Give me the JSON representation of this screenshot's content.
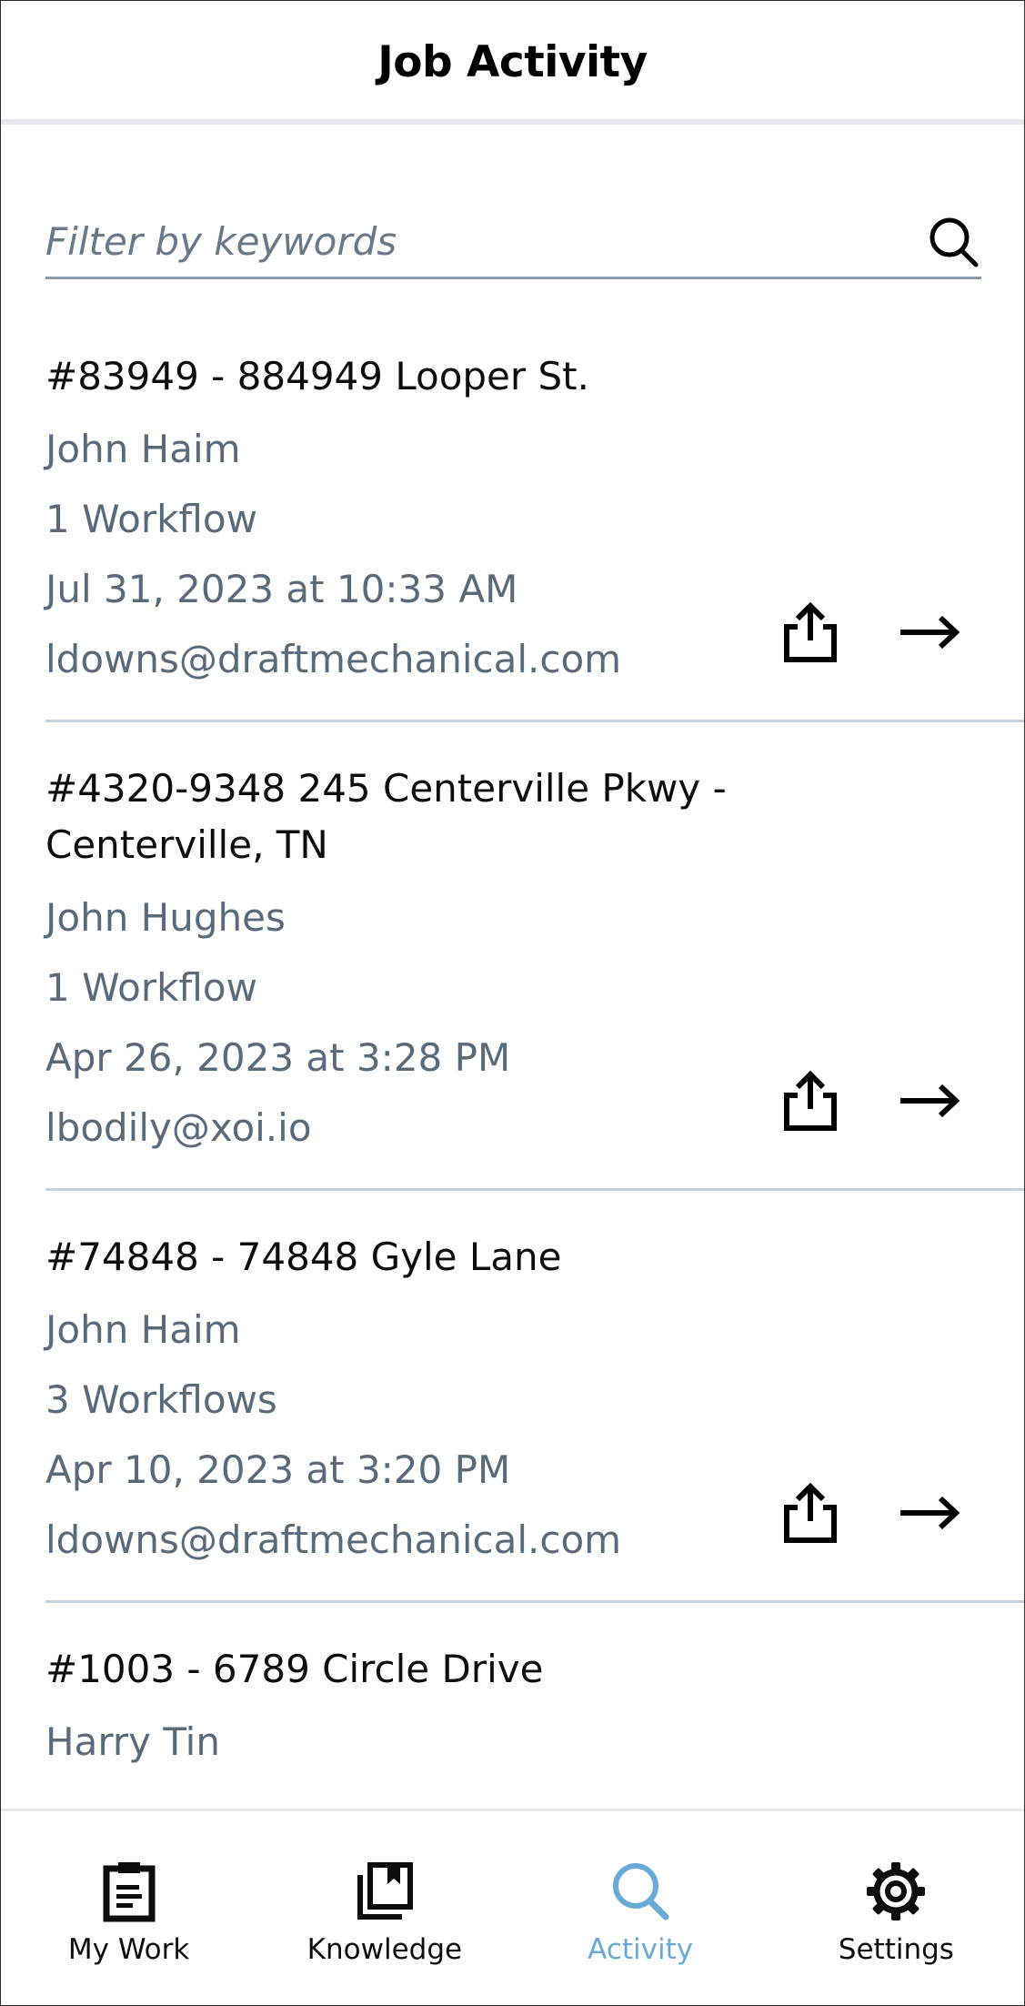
{
  "header": {
    "title": "Job Activity"
  },
  "search": {
    "placeholder": "Filter by keywords"
  },
  "jobs": [
    {
      "title": "#83949 - 884949 Looper St.",
      "technician": "John Haim",
      "workflows": "1 Workflow",
      "date": "Jul 31, 2023 at 10:33 AM",
      "email": "ldowns@draftmechanical.com"
    },
    {
      "title": "#4320-9348 245 Centerville Pkwy - Centerville, TN",
      "technician": "John Hughes",
      "workflows": "1 Workflow",
      "date": "Apr 26, 2023 at 3:28 PM",
      "email": "lbodily@xoi.io"
    },
    {
      "title": "#74848 - 74848 Gyle Lane",
      "technician": "John Haim",
      "workflows": "3 Workflows",
      "date": "Apr 10, 2023 at 3:20 PM",
      "email": "ldowns@draftmechanical.com"
    },
    {
      "title": "#1003 - 6789 Circle Drive",
      "technician": "Harry Tin"
    }
  ],
  "nav": {
    "items": [
      {
        "label": "My Work",
        "icon": "clipboard-icon"
      },
      {
        "label": "Knowledge",
        "icon": "library-icon"
      },
      {
        "label": "Activity",
        "icon": "search-icon",
        "active": true
      },
      {
        "label": "Settings",
        "icon": "gear-icon"
      }
    ]
  },
  "colors": {
    "accent": "#6aaad6",
    "secondary_text": "#5b6a7b",
    "divider": "#c8d2dc"
  }
}
